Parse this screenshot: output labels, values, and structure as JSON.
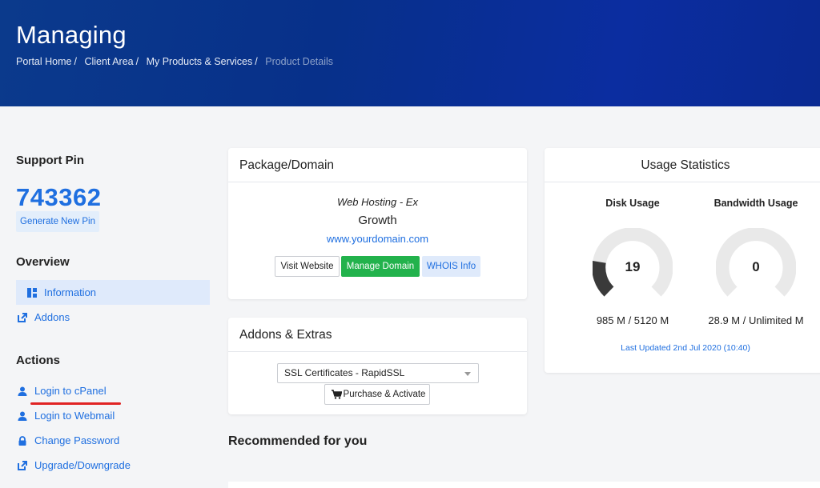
{
  "header": {
    "title": "Managing",
    "breadcrumb": [
      "Portal Home",
      "Client Area",
      "My Products & Services"
    ],
    "breadcrumb_active": "Product Details"
  },
  "sidebar": {
    "support_pin_heading": "Support Pin",
    "pin": "743362",
    "generate_pin_label": "Generate New Pin",
    "overview_heading": "Overview",
    "overview_items": [
      {
        "label": "Information",
        "icon": "dashboard-icon"
      },
      {
        "label": "Addons",
        "icon": "external-link-icon"
      }
    ],
    "actions_heading": "Actions",
    "action_items": [
      {
        "label": "Login to cPanel",
        "icon": "user-icon"
      },
      {
        "label": "Login to Webmail",
        "icon": "user-icon"
      },
      {
        "label": "Change Password",
        "icon": "lock-icon"
      },
      {
        "label": "Upgrade/Downgrade",
        "icon": "external-link-icon"
      }
    ]
  },
  "package": {
    "heading": "Package/Domain",
    "type": "Web Hosting - Ex",
    "name": "Growth",
    "domain": "www.yourdomain.com",
    "visit_label": "Visit Website",
    "manage_label": "Manage Domain",
    "whois_label": "WHOIS Info"
  },
  "addons": {
    "heading": "Addons & Extras",
    "selected": "SSL Certificates - RapidSSL",
    "purchase_label": "Purchase & Activate"
  },
  "usage": {
    "heading": "Usage Statistics",
    "disk_label": "Disk Usage",
    "disk_percent": "19",
    "disk_value": "985 M / 5120 M",
    "bandwidth_label": "Bandwidth Usage",
    "bandwidth_percent": "0",
    "bandwidth_value": "28.9 M / Unlimited M",
    "updated": "Last Updated 2nd Jul 2020 (10:40)"
  },
  "recommended_heading": "Recommended for you",
  "colors": {
    "accent": "#1f6fe0",
    "success": "#22b24c",
    "hero": "#0b3a8c",
    "highlight": "#e02424"
  }
}
